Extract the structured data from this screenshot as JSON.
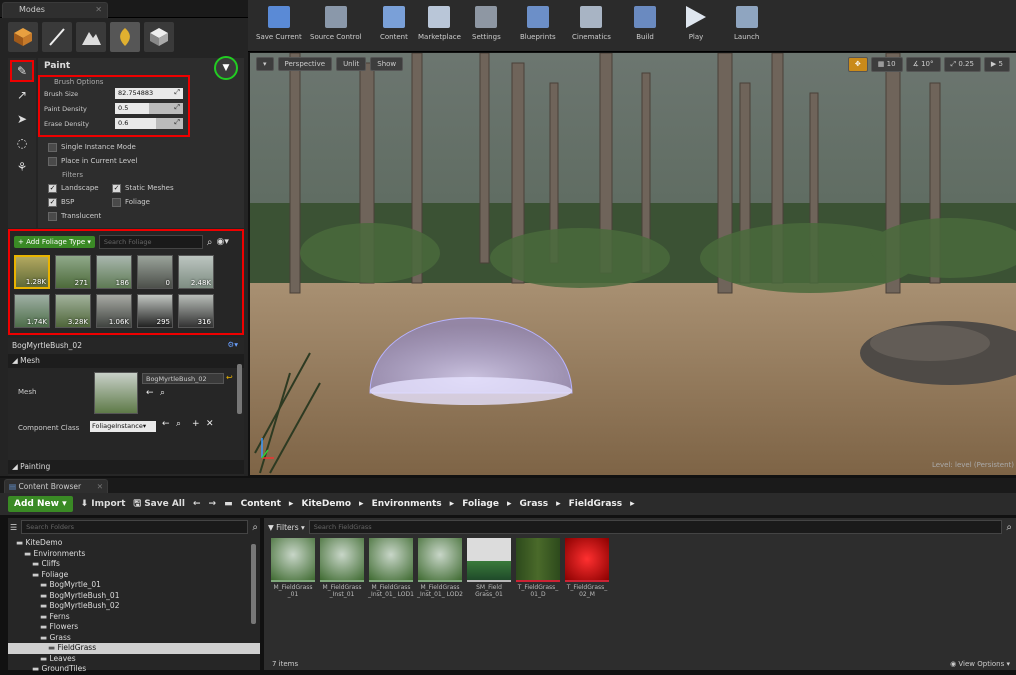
{
  "modes": {
    "tab_title": "Modes",
    "section_title": "Paint",
    "brush_options_label": "Brush Options",
    "brush_size_label": "Brush Size",
    "brush_size_value": "82.754883",
    "paint_density_label": "Paint Density",
    "paint_density_value": "0.5",
    "erase_density_label": "Erase Density",
    "erase_density_value": "0.6",
    "single_instance_label": "Single Instance Mode",
    "place_current_level_label": "Place in Current Level",
    "filters_label": "Filters",
    "filters": [
      {
        "label": "Landscape",
        "checked": true
      },
      {
        "label": "Static Meshes",
        "checked": true
      },
      {
        "label": "BSP",
        "checked": true
      },
      {
        "label": "Foliage",
        "checked": false
      },
      {
        "label": "Translucent",
        "checked": false
      }
    ],
    "add_foliage_label": "+ Add Foliage Type ▾",
    "search_foliage_placeholder": "Search Foliage",
    "foliage_thumbs": [
      "1.28K",
      "271",
      "186",
      "0",
      "2.48K",
      "1.74K",
      "3.28K",
      "1.06K",
      "295",
      "316"
    ],
    "selected_foliage": "BogMyrtleBush_02",
    "mesh_group": "◢ Mesh",
    "mesh_label": "Mesh",
    "mesh_value": "BogMyrtleBush_02",
    "component_class_label": "Component Class",
    "component_class_value": "FoliageInstance▾",
    "painting_group": "◢ Painting"
  },
  "toolbar": {
    "items": [
      "Save Current",
      "Source Control",
      "Content",
      "Marketplace",
      "Settings",
      "Blueprints",
      "Cinematics",
      "Build",
      "Play",
      "Launch"
    ]
  },
  "viewport": {
    "perspective": "Perspective",
    "unlit": "Unlit",
    "show": "Show",
    "grid_snap": "10",
    "rot_snap": "10°",
    "scale_snap": "0.25",
    "cam_speed": "5",
    "level_label": "Level:",
    "level_value": "level (Persistent)"
  },
  "content_browser": {
    "tab_title": "Content Browser",
    "add_new": "Add New ▾",
    "import": "Import",
    "save_all": "Save All",
    "breadcrumbs": [
      "Content",
      "KiteDemo",
      "Environments",
      "Foliage",
      "Grass",
      "FieldGrass"
    ],
    "search_folders_placeholder": "Search Folders",
    "filters_label": "Filters ▾",
    "search_assets_placeholder": "Search FieldGrass",
    "folders": [
      {
        "label": "KiteDemo",
        "indent": 0
      },
      {
        "label": "Environments",
        "indent": 1
      },
      {
        "label": "Cliffs",
        "indent": 2
      },
      {
        "label": "Foliage",
        "indent": 2
      },
      {
        "label": "BogMyrtle_01",
        "indent": 3
      },
      {
        "label": "BogMyrtleBush_01",
        "indent": 3
      },
      {
        "label": "BogMyrtleBush_02",
        "indent": 3
      },
      {
        "label": "Ferns",
        "indent": 3
      },
      {
        "label": "Flowers",
        "indent": 3
      },
      {
        "label": "Grass",
        "indent": 3
      },
      {
        "label": "FieldGrass",
        "indent": 4
      },
      {
        "label": "Leaves",
        "indent": 3
      },
      {
        "label": "GroundTiles",
        "indent": 2
      }
    ],
    "assets": [
      {
        "label": "M_FieldGrass _01",
        "kind": "grass"
      },
      {
        "label": "M_FieldGrass _Inst_01",
        "kind": "grass"
      },
      {
        "label": "M_FieldGrass _Inst_01_ LOD1",
        "kind": "grass"
      },
      {
        "label": "M_FieldGrass _Inst_01_ LOD2",
        "kind": "grass"
      },
      {
        "label": "SM_Field Grass_01",
        "kind": "mesh"
      },
      {
        "label": "T_FieldGrass_ 01_D",
        "kind": "texd"
      },
      {
        "label": "T_FieldGrass_ 02_M",
        "kind": "texm"
      }
    ],
    "item_count": "7 items",
    "view_options": "View Options ▾"
  },
  "colors": {
    "highlight_red": "#e00000",
    "accent_green": "#3a8a25",
    "select_yellow": "#e9b300"
  }
}
